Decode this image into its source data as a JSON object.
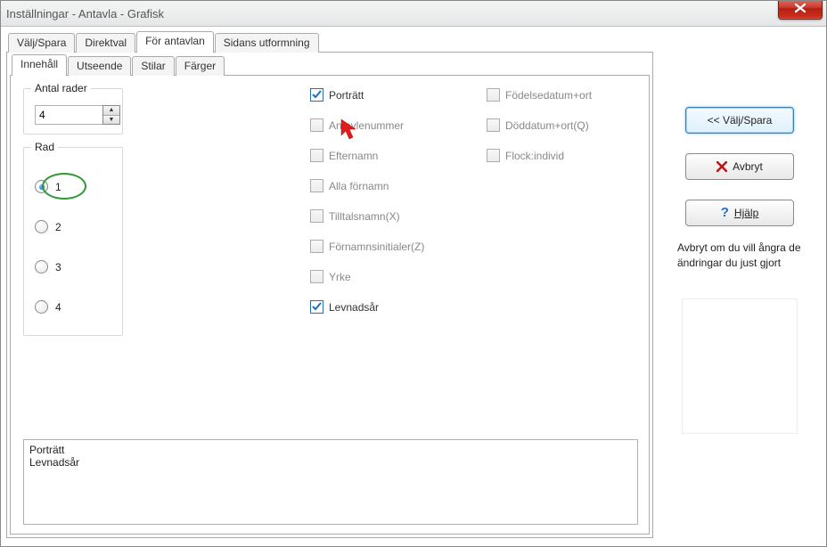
{
  "window": {
    "title": "Inställningar - Antavla - Grafisk"
  },
  "tabs_primary": {
    "items": [
      "Välj/Spara",
      "Direktval",
      "För antavlan",
      "Sidans utformning"
    ],
    "active": 2
  },
  "tabs_secondary": {
    "items": [
      "Innehåll",
      "Utseende",
      "Stilar",
      "Färger"
    ],
    "active": 0
  },
  "left_panel": {
    "rows_label": "Antal rader",
    "rows_value": "4",
    "rad_label": "Rad",
    "rad_options": [
      "1",
      "2",
      "3",
      "4"
    ],
    "rad_selected": 0
  },
  "check_columns": [
    [
      {
        "label": "Porträtt",
        "checked": true
      },
      {
        "label": "Antavlenummer",
        "checked": false
      },
      {
        "label": "Efternamn",
        "checked": false
      },
      {
        "label": "Alla förnamn",
        "checked": false
      },
      {
        "label": "Tilltalsnamn(X)",
        "checked": false
      },
      {
        "label": "Förnamnsinitialer(Z)",
        "checked": false
      },
      {
        "label": "Yrke",
        "checked": false
      },
      {
        "label": "Levnadsår",
        "checked": true
      }
    ],
    [
      {
        "label": "Födelsedatum+ort",
        "checked": false
      },
      {
        "label": "Döddatum+ort(Q)",
        "checked": false
      },
      {
        "label": "Flock:individ",
        "checked": false
      }
    ]
  ],
  "summary": "Porträtt\nLevnadsår",
  "side": {
    "btn_select_save": "<< Välj/Spara",
    "btn_cancel": "Avbryt",
    "btn_help": "Hjälp",
    "note": "Avbryt om du vill ångra de ändringar du just gjort"
  },
  "icons": {
    "close": "close-icon",
    "cancel_x": "cancel-x-icon",
    "help_q": "help-question-icon",
    "cursor": "cursor-arrow-icon"
  }
}
